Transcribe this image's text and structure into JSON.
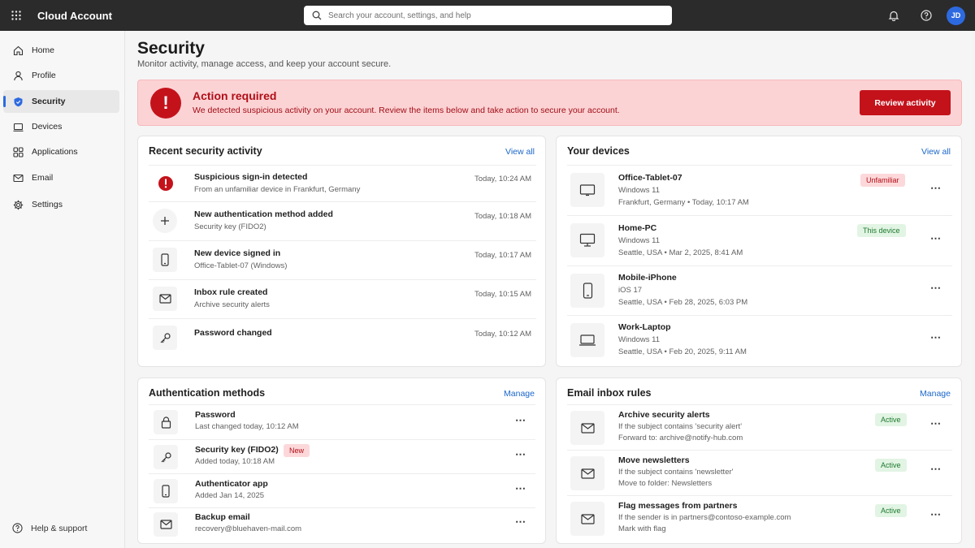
{
  "app": {
    "title": "Cloud Account"
  },
  "search": {
    "placeholder": "Search your account, settings, and help"
  },
  "user": {
    "initials": "JD"
  },
  "sidebar": {
    "items": [
      {
        "label": "Home",
        "icon": "home-icon"
      },
      {
        "label": "Profile",
        "icon": "person-icon"
      },
      {
        "label": "Security",
        "icon": "shield-icon"
      },
      {
        "label": "Devices",
        "icon": "laptop-icon"
      },
      {
        "label": "Applications",
        "icon": "grid-icon"
      },
      {
        "label": "Email",
        "icon": "mail-icon"
      },
      {
        "label": "Settings",
        "icon": "gear-icon"
      }
    ],
    "help_label": "Help & support"
  },
  "page": {
    "title": "Security",
    "subtitle": "Monitor activity, manage access, and keep your account secure."
  },
  "alert": {
    "title": "Action required",
    "text": "We detected suspicious activity on your account. Review the items below and take action to secure your account.",
    "button": "Review activity"
  },
  "activity": {
    "title": "Recent security activity",
    "link": "View all",
    "items": [
      {
        "title": "Suspicious sign-in detected",
        "sub": "From an unfamiliar device in Frankfurt, Germany",
        "time": "Today, 10:24 AM"
      },
      {
        "title": "New authentication method added",
        "sub": "Security key (FIDO2)",
        "time": "Today, 10:18 AM"
      },
      {
        "title": "New device signed in",
        "sub": "Office-Tablet-07 (Windows)",
        "time": "Today, 10:17 AM"
      },
      {
        "title": "Inbox rule created",
        "sub": "Archive security alerts",
        "time": "Today, 10:15 AM"
      },
      {
        "title": "Password changed",
        "sub": "",
        "time": "Today, 10:12 AM"
      }
    ]
  },
  "devices": {
    "title": "Your devices",
    "link": "View all",
    "items": [
      {
        "name": "Office-Tablet-07",
        "os": "Windows 11",
        "detail": "Frankfurt, Germany  •  Today, 10:17 AM",
        "badge": "Unfamiliar"
      },
      {
        "name": "Home-PC",
        "os": "Windows 11",
        "detail": "Seattle, USA  •  Mar 2, 2025, 8:41 AM",
        "badge": "This device"
      },
      {
        "name": "Mobile-iPhone",
        "os": "iOS 17",
        "detail": "Seattle, USA  •  Feb 28, 2025, 6:03 PM",
        "badge": ""
      },
      {
        "name": "Work-Laptop",
        "os": "Windows 11",
        "detail": "Seattle, USA  •  Feb 20, 2025, 9:11 AM",
        "badge": ""
      }
    ]
  },
  "auth": {
    "title": "Authentication methods",
    "link": "Manage",
    "items": [
      {
        "name": "Password",
        "sub": "Last changed today, 10:12 AM",
        "badge": ""
      },
      {
        "name": "Security key (FIDO2)",
        "sub": "Added today, 10:18 AM",
        "badge": "New"
      },
      {
        "name": "Authenticator app",
        "sub": "Added Jan 14, 2025",
        "badge": ""
      },
      {
        "name": "Backup email",
        "sub": "recovery@bluehaven-mail.com",
        "badge": ""
      }
    ]
  },
  "rules": {
    "title": "Email inbox rules",
    "link": "Manage",
    "items": [
      {
        "name": "Archive security alerts",
        "condition": "If the subject contains 'security alert'",
        "action": "Forward to: archive@notify-hub.com",
        "status": "Active"
      },
      {
        "name": "Move newsletters",
        "condition": "If the subject contains 'newsletter'",
        "action": "Move to folder: Newsletters",
        "status": "Active"
      },
      {
        "name": "Flag messages from partners",
        "condition": "If the sender is in partners@contoso-example.com",
        "action": "Mark with flag",
        "status": "Active"
      }
    ]
  },
  "more_glyph": "⋯"
}
